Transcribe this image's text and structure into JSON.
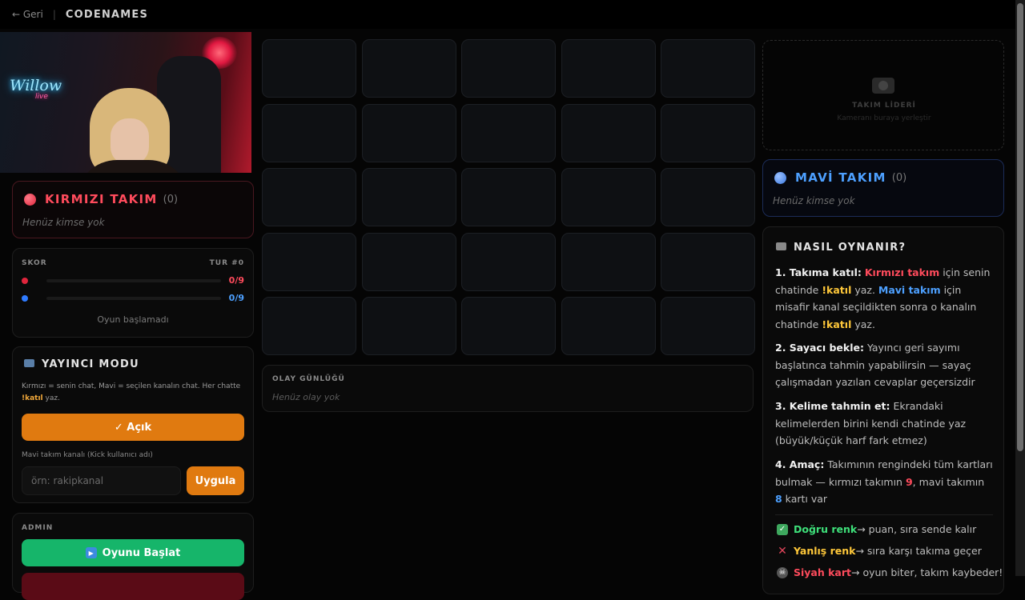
{
  "topbar": {
    "back": "← Geri",
    "separator": "|",
    "title": "CODENAMES"
  },
  "red_team": {
    "name": "KIRMIZI TAKIM",
    "count": "(0)",
    "empty": "Henüz kimse yok",
    "color": "#ff4b5c"
  },
  "score": {
    "label": "SKOR",
    "turn": "TUR #0",
    "red_value": "0/9",
    "blue_value": "0/9",
    "status": "Oyun başlamadı"
  },
  "broadcaster": {
    "title": "YAYINCI MODU",
    "desc_1": "Kırmızı = senin chat, Mavi = seçilen kanalın chat. Her chatte ",
    "desc_cmd": "!katıl",
    "desc_2": " yaz.",
    "toggle": "✓ Açık",
    "channel_label": "Mavi takım kanalı (Kick kullanıcı adı)",
    "channel_placeholder": "örn: rakipkanal",
    "apply": "Uygula"
  },
  "admin": {
    "label": "ADMIN",
    "start": "Oyunu Başlat"
  },
  "event_log": {
    "label": "OLAY GÜNLÜĞÜ",
    "empty": "Henüz olay yok"
  },
  "leader_cam": {
    "title": "TAKIM LİDERİ",
    "subtitle": "Kameranı buraya yerleştir"
  },
  "blue_team": {
    "name": "MAVİ TAKIM",
    "count": "(0)",
    "empty": "Henüz kimse yok",
    "color": "#4da0ff"
  },
  "howto": {
    "title": "NASIL OYNANIR?",
    "s1_title": "1. Takıma katıl:",
    "s1_red": "Kırmızı takım",
    "s1_a": " için senin chatinde ",
    "s1_cmd": "!katıl",
    "s1_b": " yaz. ",
    "s1_blue": "Mavi takım",
    "s1_c": " için misafir kanal seçildikten sonra o kanalın chatinde ",
    "s1_cmd2": "!katıl",
    "s1_d": " yaz.",
    "s2_title": "2. Sayacı bekle:",
    "s2_text": " Yayıncı geri sayımı başlatınca tahmin yapabilirsin — sayaç çalışmadan yazılan cevaplar geçersizdir",
    "s3_title": "3. Kelime tahmin et:",
    "s3_text": " Ekrandaki kelimelerden birini kendi chatinde yaz (büyük/küçük harf fark etmez)",
    "s4_title": "4. Amaç:",
    "s4_a": " Takımının rengindeki tüm kartları bulmak — kırmızı takımın ",
    "s4_red": "9",
    "s4_b": ", mavi takımın ",
    "s4_blue": "8",
    "s4_c": " kartı var",
    "l1_label": "Doğru renk",
    "l1_text": " → puan, sıra sende kalır",
    "l2_label": "Yanlış renk",
    "l2_text": " → sıra karşı takıma geçer",
    "l3_label": "Siyah kart",
    "l3_text": " → oyun biter, takım kaybeder!"
  },
  "stream": {
    "neon_text": "Willow",
    "neon_sub": "live"
  },
  "board": {
    "rows": 5,
    "cols": 5
  }
}
